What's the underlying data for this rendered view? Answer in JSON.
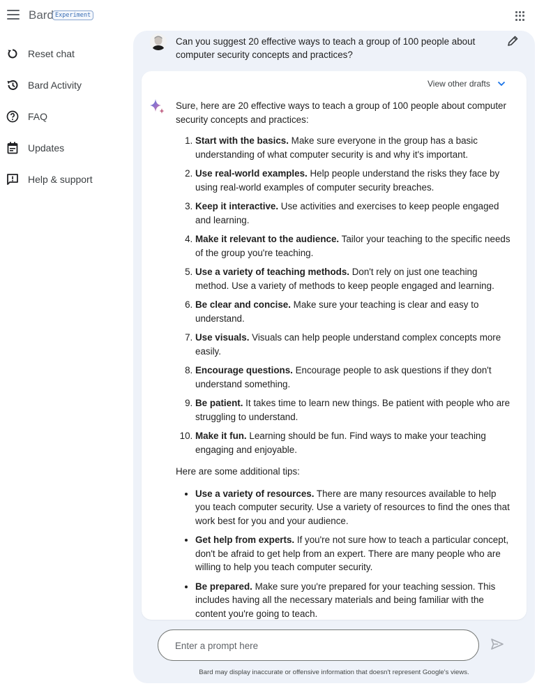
{
  "header": {
    "app_name": "Bard",
    "badge": "Experiment",
    "menu_icon": "hamburger-menu-icon",
    "apps_icon": "google-apps-grid-icon"
  },
  "sidebar": {
    "items": [
      {
        "label": "Reset chat",
        "icon": "reset-icon"
      },
      {
        "label": "Bard Activity",
        "icon": "history-icon"
      },
      {
        "label": "FAQ",
        "icon": "help-circle-icon"
      },
      {
        "label": "Updates",
        "icon": "calendar-icon"
      },
      {
        "label": "Help & support",
        "icon": "feedback-icon"
      }
    ]
  },
  "prompt": {
    "text": "Can you suggest 20 effective ways to teach a group of 100 people about computer security concepts and practices?",
    "edit_icon": "pencil-icon"
  },
  "response": {
    "view_drafts_label": "View other drafts",
    "intro": "Sure, here are 20 effective ways to teach a group of 100 people about computer security concepts and practices:",
    "numbered": [
      {
        "bold": "Start with the basics.",
        "text": " Make sure everyone in the group has a basic understanding of what computer security is and why it's important."
      },
      {
        "bold": "Use real-world examples.",
        "text": " Help people understand the risks they face by using real-world examples of computer security breaches."
      },
      {
        "bold": "Keep it interactive.",
        "text": " Use activities and exercises to keep people engaged and learning."
      },
      {
        "bold": "Make it relevant to the audience.",
        "text": " Tailor your teaching to the specific needs of the group you're teaching."
      },
      {
        "bold": "Use a variety of teaching methods.",
        "text": " Don't rely on just one teaching method. Use a variety of methods to keep people engaged and learning."
      },
      {
        "bold": "Be clear and concise.",
        "text": " Make sure your teaching is clear and easy to understand."
      },
      {
        "bold": "Use visuals.",
        "text": " Visuals can help people understand complex concepts more easily."
      },
      {
        "bold": "Encourage questions.",
        "text": " Encourage people to ask questions if they don't understand something."
      },
      {
        "bold": "Be patient.",
        "text": " It takes time to learn new things. Be patient with people who are struggling to understand."
      },
      {
        "bold": "Make it fun.",
        "text": " Learning should be fun. Find ways to make your teaching engaging and enjoyable."
      }
    ],
    "tips_heading": "Here are some additional tips:",
    "bullets": [
      {
        "bold": "Use a variety of resources.",
        "text": " There are many resources available to help you teach computer security. Use a variety of resources to find the ones that work best for you and your audience."
      },
      {
        "bold": "Get help from experts.",
        "text": " If you're not sure how to teach a particular concept, don't be afraid to get help from an expert. There are many people who are willing to help you teach computer security."
      },
      {
        "bold": "Be prepared.",
        "text": " Make sure you're prepared for your teaching session. This includes having all the necessary materials and being familiar with the content you're going to teach."
      }
    ]
  },
  "input": {
    "placeholder": "Enter a prompt here",
    "value": ""
  },
  "disclaimer": "Bard may display inaccurate or offensive information that doesn't represent Google's views.",
  "colors": {
    "panel_bg": "#eef2f9",
    "accent_blue": "#1a73e8",
    "badge_blue": "#3b6fb6",
    "text_primary": "#1f1f1f",
    "text_secondary": "#5f6368"
  }
}
